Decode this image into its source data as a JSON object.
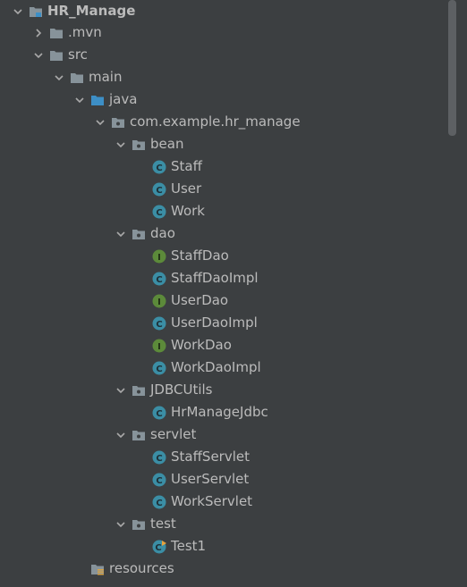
{
  "project_tree": {
    "root": "HR_Manage",
    "mvn": ".mvn",
    "src": "src",
    "main": "main",
    "java": "java",
    "package": "com.example.hr_manage",
    "bean": {
      "label": "bean",
      "items": [
        "Staff",
        "User",
        "Work"
      ]
    },
    "dao": {
      "label": "dao",
      "items": [
        "StaffDao",
        "StaffDaoImpl",
        "UserDao",
        "UserDaoImpl",
        "WorkDao",
        "WorkDaoImpl"
      ]
    },
    "jdbc": {
      "label": "JDBCUtils",
      "items": [
        "HrManageJdbc"
      ]
    },
    "servlet": {
      "label": "servlet",
      "items": [
        "StaffServlet",
        "UserServlet",
        "WorkServlet"
      ]
    },
    "test": {
      "label": "test",
      "items": [
        "Test1"
      ]
    },
    "resources": "resources"
  },
  "colors": {
    "background": "#3c3f41",
    "text": "#bbbbbb",
    "folder": "#87939a",
    "source_folder": "#3d8fc6",
    "class_icon": "#3b8ea5",
    "interface_icon": "#5c8a3a"
  },
  "icons": {
    "class": "class-icon",
    "interface": "interface-icon",
    "folder": "folder-icon",
    "package": "package-icon",
    "expand": "chevron-down-icon",
    "collapse": "chevron-right-icon"
  }
}
